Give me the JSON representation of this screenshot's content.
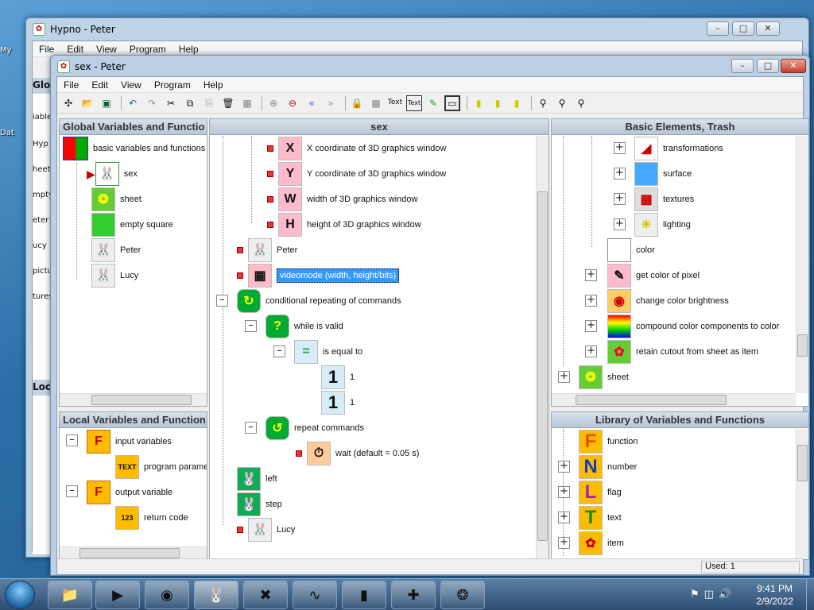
{
  "desktop": {
    "side_labels": [
      "My",
      "Dat"
    ]
  },
  "back_window": {
    "title": "Hypno - Peter",
    "menu": [
      "File",
      "Edit",
      "View",
      "Program",
      "Help"
    ],
    "panel_left_head": "Glo",
    "panel_left2_head": "Loc",
    "left_items": [
      "iable",
      "Hyp",
      "heet",
      "mpty",
      "eter",
      "ucy",
      "pictu",
      "tures"
    ]
  },
  "front_window": {
    "title": "sex - Peter",
    "menu": [
      "File",
      "Edit",
      "View",
      "Program",
      "Help"
    ],
    "toolbar_icons": [
      "program-icon",
      "open-icon",
      "save-icon",
      "undo-icon",
      "redo-icon",
      "cut-icon",
      "copy-icon",
      "paste-icon",
      "delete-icon",
      "select-all-icon",
      "zoom-in-icon",
      "zoom-out-icon",
      "back-icon",
      "forward-icon",
      "lock-icon",
      "grid-icon",
      "text-icon",
      "text-box-icon",
      "edit-icon",
      "window-icon",
      "bulb1-icon",
      "bulb2-icon",
      "bulb3-icon",
      "find-icon",
      "find-next-icon",
      "find-prev-icon"
    ],
    "global_panel": {
      "title": "Global Variables and Functio",
      "items": [
        {
          "label": "basic variables and functions",
          "icon": "palette-grid-icon"
        },
        {
          "label": "sex",
          "icon": "rabbit-icon"
        },
        {
          "label": "sheet",
          "icon": "sheet-icon"
        },
        {
          "label": "empty square",
          "icon": "empty-square-icon"
        },
        {
          "label": "Peter",
          "icon": "rabbit-icon"
        },
        {
          "label": "Lucy",
          "icon": "rabbit-icon"
        }
      ]
    },
    "local_panel": {
      "title": "Local Variables and Function",
      "items": [
        {
          "label": "input variables",
          "icon": "function-in-icon"
        },
        {
          "label": "program parame",
          "icon": "text-param-icon"
        },
        {
          "label": "output variable",
          "icon": "function-out-icon"
        },
        {
          "label": "return code",
          "icon": "code-icon"
        }
      ]
    },
    "program_panel": {
      "title": "sex",
      "items": [
        {
          "label": "X coordinate of 3D graphics window",
          "icon": "x-coord-icon"
        },
        {
          "label": "Y coordinate of 3D graphics window",
          "icon": "y-coord-icon"
        },
        {
          "label": "width of 3D graphics window",
          "icon": "width-icon"
        },
        {
          "label": "height of 3D graphics window",
          "icon": "height-icon"
        },
        {
          "label": "Peter",
          "icon": "rabbit-icon"
        },
        {
          "label": "videomode (width, height/bits)",
          "icon": "videomode-icon"
        },
        {
          "label": "conditional repeating of commands",
          "icon": "loop-icon"
        },
        {
          "label": "while is valid",
          "icon": "question-icon"
        },
        {
          "label": "is equal to",
          "icon": "equals-icon"
        },
        {
          "label": "1",
          "icon": "one-icon",
          "value": "1"
        },
        {
          "label": "1",
          "icon": "one-icon",
          "value": "1"
        },
        {
          "label": "repeat commands",
          "icon": "repeat-icon"
        },
        {
          "label": "wait (default = 0.05 s)",
          "icon": "stopwatch-icon"
        },
        {
          "label": "left",
          "icon": "rabbit-left-icon"
        },
        {
          "label": "step",
          "icon": "rabbit-step-icon"
        },
        {
          "label": "Lucy",
          "icon": "rabbit-icon"
        }
      ]
    },
    "basic_panel": {
      "title": "Basic Elements, Trash",
      "items": [
        {
          "label": "transformations",
          "icon": "axes-icon"
        },
        {
          "label": "surface",
          "icon": "surface-icon"
        },
        {
          "label": "textures",
          "icon": "texture-icon"
        },
        {
          "label": "lighting",
          "icon": "lighting-icon"
        },
        {
          "label": "color",
          "icon": "color-swatch-icon"
        },
        {
          "label": "get color of pixel",
          "icon": "pipette-icon"
        },
        {
          "label": "change color brightness",
          "icon": "palette-icon"
        },
        {
          "label": "compound color components to color",
          "icon": "palette-rainbow-icon"
        },
        {
          "label": "retain cutout from sheet as item",
          "icon": "cutout-icon"
        },
        {
          "label": "sheet",
          "icon": "sheet-icon"
        }
      ]
    },
    "library_panel": {
      "title": "Library of Variables and Functions",
      "items": [
        {
          "label": "function",
          "letter": "F",
          "color": "#e05010"
        },
        {
          "label": "number",
          "letter": "N",
          "color": "#1040c0"
        },
        {
          "label": "flag",
          "letter": "L",
          "color": "#a020c0"
        },
        {
          "label": "text",
          "letter": "T",
          "color": "#109030"
        },
        {
          "label": "item",
          "letter": "",
          "color": "#30a030"
        }
      ]
    },
    "status": "Used: 1"
  },
  "taskbar": {
    "apps": [
      "explorer-icon",
      "media-player-icon",
      "chrome-icon",
      "hypno-rabbit-icon",
      "x-app-icon",
      "oscilloscope-icon",
      "cmd-icon",
      "grid-app-icon",
      "film-reel-icon"
    ],
    "time": "9:41 PM",
    "date": "2/9/2022"
  },
  "colors": {
    "selection": "#3399ff",
    "close_button": "#c4402b",
    "panel_header": "#c5d1df"
  }
}
